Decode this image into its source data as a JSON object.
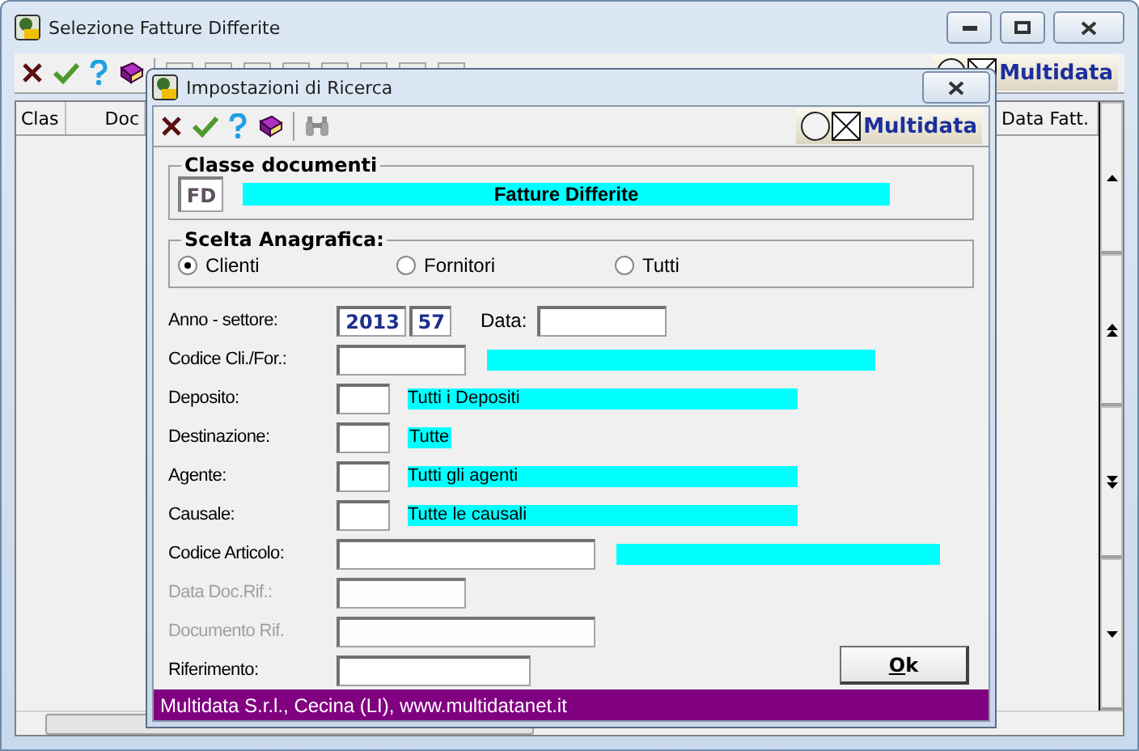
{
  "main_window": {
    "title": "Selezione Fatture Differite",
    "logo": "Multidata",
    "table": {
      "columns": [
        "Clas",
        "Doc",
        "Data Fatt."
      ]
    }
  },
  "dialog": {
    "title": "Impostazioni di Ricerca",
    "logo": "Multidata",
    "classe_documenti": {
      "label": "Classe documenti",
      "code": "FD",
      "description": "Fatture Differite"
    },
    "scelta_anagrafica": {
      "label": "Scelta Anagrafica:",
      "options": [
        {
          "label": "Clienti",
          "selected": true
        },
        {
          "label": "Fornitori",
          "selected": false
        },
        {
          "label": "Tutti",
          "selected": false
        }
      ]
    },
    "anno_settore": {
      "label": "Anno - settore:",
      "anno": "2013",
      "settore": "57",
      "data_label": "Data:"
    },
    "fields": [
      {
        "kind": "code_lookup",
        "label": "Codice Cli./For.:",
        "disabled": false
      },
      {
        "kind": "lookup",
        "label": "Deposito:",
        "description": "Tutti i Depositi",
        "disabled": false
      },
      {
        "kind": "lookup_fit",
        "label": "Destinazione:",
        "description": "Tutte",
        "disabled": false
      },
      {
        "kind": "lookup",
        "label": "Agente:",
        "description": "Tutti gli agenti",
        "disabled": false
      },
      {
        "kind": "lookup",
        "label": "Causale:",
        "description": "Tutte le causali",
        "disabled": false
      },
      {
        "kind": "article_lookup",
        "label": "Codice Articolo:",
        "disabled": false
      },
      {
        "kind": "date",
        "label": "Data Doc.Rif.:",
        "disabled": true
      },
      {
        "kind": "text",
        "label": "Documento Rif.",
        "disabled": true
      },
      {
        "kind": "reference",
        "label": "Riferimento:",
        "disabled": false
      }
    ],
    "ok_button": "Ok",
    "footer": "Multidata S.r.l., Cecina (LI), www.multidatanet.it"
  }
}
